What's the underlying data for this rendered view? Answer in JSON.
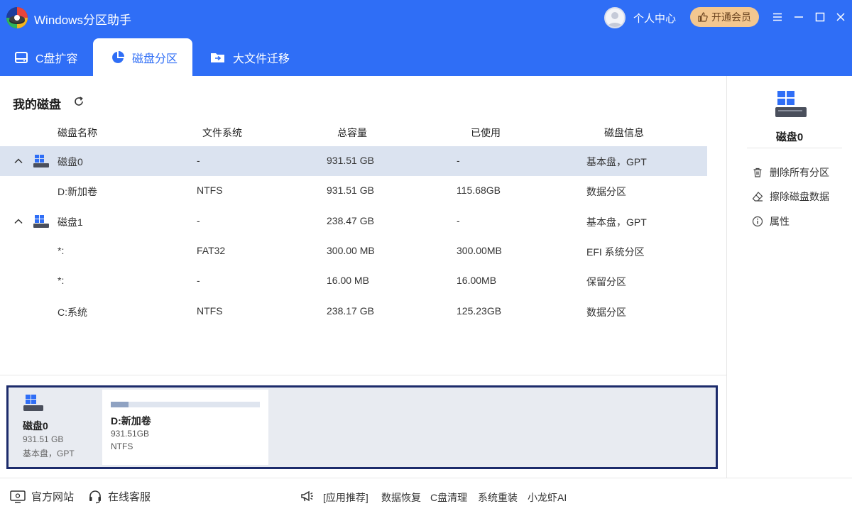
{
  "app": {
    "title": "Windows分区助手",
    "user_center": "个人中心",
    "vip_label": "开通会员"
  },
  "tabs": [
    {
      "label": "C盘扩容"
    },
    {
      "label": "磁盘分区",
      "active": true
    },
    {
      "label": "大文件迁移"
    }
  ],
  "disk_list": {
    "title": "我的磁盘",
    "columns": [
      "磁盘名称",
      "文件系统",
      "总容量",
      "已使用",
      "磁盘信息"
    ],
    "rows": [
      {
        "name": "磁盘0",
        "fs": "-",
        "capacity": "931.51 GB",
        "used": "-",
        "info": "基本盘，GPT",
        "is_disk": true,
        "selected": true
      },
      {
        "name": "D:新加卷",
        "fs": "NTFS",
        "capacity": "931.51 GB",
        "used": "115.68GB",
        "info": "数据分区"
      },
      {
        "name": "磁盘1",
        "fs": "-",
        "capacity": "238.47 GB",
        "used": "-",
        "info": "基本盘，GPT",
        "is_disk": true
      },
      {
        "name": "*:",
        "fs": "FAT32",
        "capacity": "300.00 MB",
        "used": "300.00MB",
        "info": "EFI 系统分区"
      },
      {
        "name": "*:",
        "fs": "-",
        "capacity": "16.00 MB",
        "used": "16.00MB",
        "info": "保留分区"
      },
      {
        "name": "C:系统",
        "fs": "NTFS",
        "capacity": "238.17 GB",
        "used": "125.23GB",
        "info": "数据分区"
      }
    ]
  },
  "disk_map": {
    "disk_name": "磁盘0",
    "disk_capacity": "931.51 GB",
    "disk_type": "基本盘，GPT",
    "partitions": [
      {
        "name": "D:新加卷",
        "size": "931.51GB",
        "fs": "NTFS",
        "usage_fraction": 0.12
      }
    ]
  },
  "right_panel": {
    "disk_name": "磁盘0",
    "actions": [
      {
        "label": "删除所有分区",
        "icon": "trash-icon"
      },
      {
        "label": "擦除磁盘数据",
        "icon": "eraser-icon"
      },
      {
        "label": "属性",
        "icon": "info-icon"
      }
    ]
  },
  "footer": {
    "website": "官方网站",
    "service": "在线客服",
    "links": [
      "[应用推荐]",
      "数据恢复",
      "C盘清理",
      "系统重装",
      "小龙虾AI"
    ]
  },
  "colors": {
    "primary": "#2f6ef6",
    "selected_row": "#dbe3f0",
    "map_border": "#1c2b6b",
    "vip": "#f3c790"
  }
}
